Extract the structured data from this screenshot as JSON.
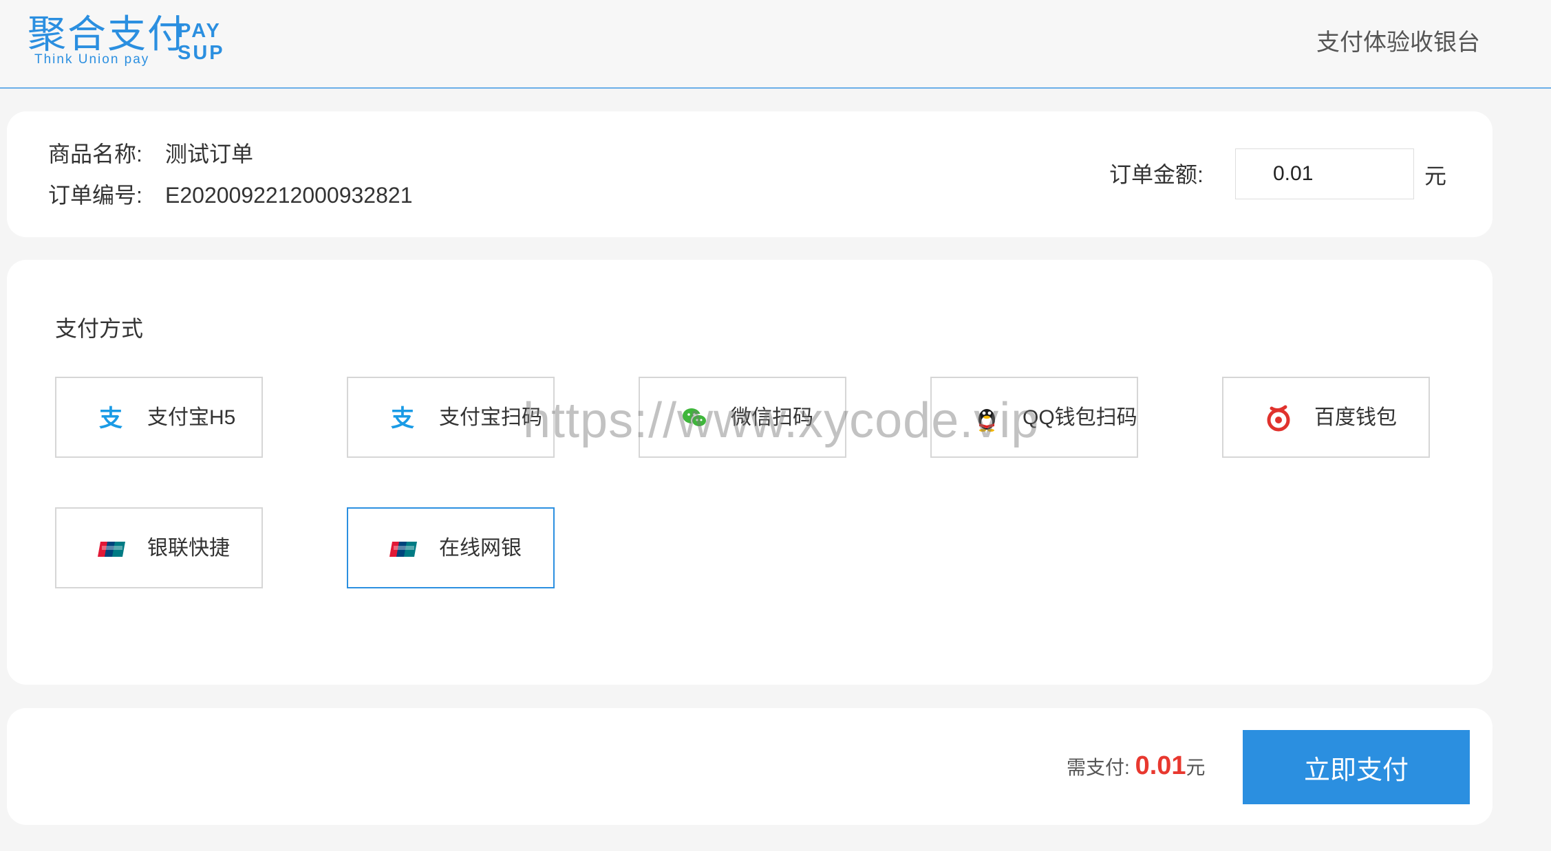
{
  "header": {
    "logo": {
      "cn": "聚合支付",
      "pay": "PAY",
      "sup": "SUP",
      "en": "Think Union pay"
    },
    "title": "支付体验收银台"
  },
  "order": {
    "name_label": "商品名称:",
    "name_value": "测试订单",
    "id_label": "订单编号:",
    "id_value": "E20200922120009328 21",
    "amount_label": "订单金额:",
    "amount_value": "0.01",
    "amount_unit": "元"
  },
  "methods": {
    "title": "支付方式",
    "items": [
      {
        "label": "支付宝H5",
        "icon": "alipay-icon",
        "selected": false
      },
      {
        "label": "支付宝扫码",
        "icon": "alipay-icon",
        "selected": false
      },
      {
        "label": "微信扫码",
        "icon": "wechat-icon",
        "selected": false
      },
      {
        "label": "QQ钱包扫码",
        "icon": "qq-icon",
        "selected": false
      },
      {
        "label": "百度钱包",
        "icon": "baidu-wallet-icon",
        "selected": false
      },
      {
        "label": "银联快捷",
        "icon": "unionpay-icon",
        "selected": false
      },
      {
        "label": "在线网银",
        "icon": "unionpay-icon",
        "selected": true
      }
    ]
  },
  "watermark": "https://www.xycode.vip",
  "footer": {
    "need_pay_label": "需支付:",
    "need_pay_amount": "0.01",
    "need_pay_unit": "元",
    "pay_button": "立即支付"
  },
  "colors": {
    "accent": "#2b8fe0",
    "price": "#e8382f"
  }
}
